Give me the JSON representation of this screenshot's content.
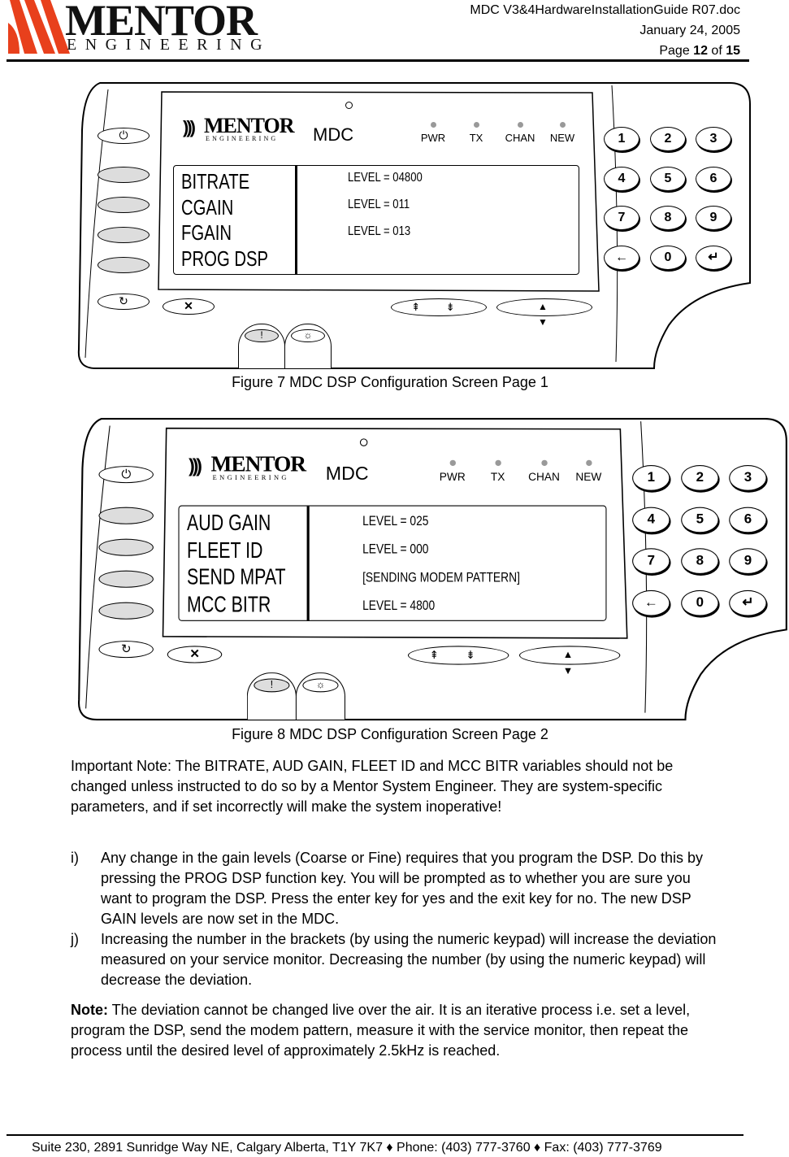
{
  "header": {
    "logo_top": "MENTOR",
    "logo_bottom": "ENGINEERING",
    "doc_name": "MDC V3&4HardwareInstallationGuide R07.doc",
    "date": "January 24, 2005",
    "page_prefix": "Page ",
    "page_num": "12",
    "page_of": " of ",
    "page_total": "15"
  },
  "figures": [
    {
      "caption": "Figure 7 MDC DSP Configuration Screen Page 1",
      "menu": [
        "BITRATE",
        "CGAIN",
        "FGAIN",
        "PROG DSP"
      ],
      "values": [
        "LEVEL = 04800",
        "LEVEL = 011",
        "LEVEL = 013"
      ]
    },
    {
      "caption": "Figure 8 MDC DSP Configuration Screen Page 2",
      "menu": [
        "AUD GAIN",
        "FLEET ID",
        "SEND MPAT",
        "MCC BITR"
      ],
      "values": [
        "LEVEL = 025",
        "LEVEL = 000",
        "[SENDING MODEM PATTERN]",
        "LEVEL = 4800"
      ]
    }
  ],
  "device": {
    "logo_top": "MENTOR",
    "logo_bottom": "ENGINEERING",
    "model": "MDC",
    "leds": [
      "PWR",
      "TX",
      "CHAN",
      "NEW"
    ],
    "keys": [
      "1",
      "2",
      "3",
      "4",
      "5",
      "6",
      "7",
      "8",
      "9",
      "←",
      "0",
      "↵"
    ],
    "power": "⏻",
    "cycle": "↻",
    "exit": "✕",
    "alert": "!",
    "light": "☼",
    "nav1": "⇞ ⇟",
    "nav2": "▲ ▼"
  },
  "body": {
    "important": "Important Note: The BITRATE, AUD GAIN, FLEET ID and MCC BITR variables should not be changed unless instructed to do so by a Mentor System Engineer. They are system-specific parameters, and if set incorrectly will make the system inoperative!",
    "items": [
      {
        "marker": "i)",
        "text": "Any change in the gain levels (Coarse or Fine) requires that you program the DSP. Do this by pressing the PROG DSP function key. You will be prompted as to whether you are sure you want to program the DSP. Press the enter key for yes and the exit key for no. The new DSP GAIN  levels are now set in the MDC."
      },
      {
        "marker": "j)",
        "text": "Increasing the number in the brackets (by using the numeric keypad) will increase the deviation measured on your service monitor. Decreasing the number (by using the numeric keypad) will decrease the deviation."
      }
    ],
    "note_label": "Note:",
    "note_text": " The deviation cannot be changed live over the air. It is an iterative process i.e. set a level,  program the DSP, send the modem pattern, measure it with the service monitor, then repeat the process until the desired level of approximately 2.5kHz is reached."
  },
  "footer": {
    "text": "Suite 230, 2891 Sunridge Way NE, Calgary Alberta, T1Y 7K7  ♦  Phone: (403) 777-3760  ♦  Fax: (403) 777-3769"
  },
  "colors": {
    "logo_red": "#e8401c"
  }
}
